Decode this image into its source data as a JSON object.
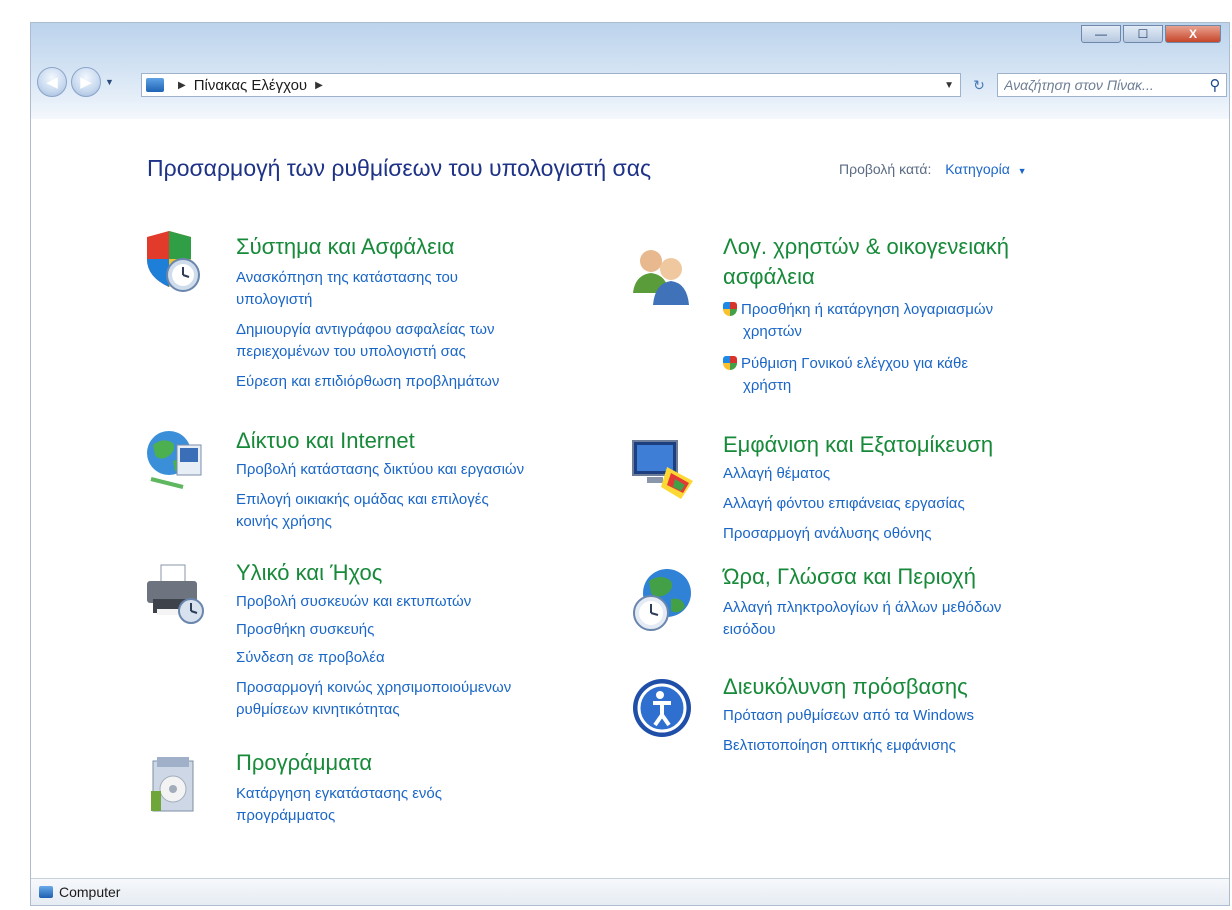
{
  "window": {
    "controls": {
      "minimize": "—",
      "maximize": "☐",
      "close": "X"
    }
  },
  "nav": {
    "back_icon": "back-arrow-icon",
    "forward_icon": "forward-arrow-icon"
  },
  "address": {
    "crumb": "Πίνακας Ελέγχου"
  },
  "search": {
    "placeholder": "Αναζήτηση στον Πίνακ..."
  },
  "header": {
    "title": "Προσαρμογή των ρυθμίσεων του υπολογιστή σας",
    "view_by_label": "Προβολή κατά:",
    "view_by_value": "Κατηγορία"
  },
  "categories": {
    "system": {
      "title": "Σύστημα και Ασφάλεια",
      "links": [
        "Ανασκόπηση της κατάστασης του",
        "υπολογιστή",
        "Δημιουργία αντιγράφου ασφαλείας των",
        "περιεχομένων του υπολογιστή σας",
        "Εύρεση και επιδιόρθωση προβλημάτων"
      ]
    },
    "network": {
      "title": "Δίκτυο και Internet",
      "links": [
        "Προβολή κατάστασης δικτύου και εργασιών",
        "Επιλογή οικιακής ομάδας και επιλογές",
        "κοινής χρήσης"
      ]
    },
    "hardware": {
      "title": "Υλικό και Ήχος",
      "links": [
        "Προβολή συσκευών και εκτυπωτών",
        "Προσθήκη συσκευής",
        "Σύνδεση σε προβολέα",
        "Προσαρμογή κοινώς χρησιμοποιούμενων",
        "ρυθμίσεων κινητικότητας"
      ]
    },
    "programs": {
      "title": "Προγράμματα",
      "links": [
        "Κατάργηση εγκατάστασης ενός",
        "προγράμματος"
      ]
    },
    "users": {
      "title_line1": "Λογ. χρηστών & οικογενειακή",
      "title_line2": "ασφάλεια",
      "links": [
        "Προσθήκη ή κατάργηση λογαριασμών",
        "χρηστών",
        "Ρύθμιση Γονικού ελέγχου για κάθε",
        "χρήστη"
      ]
    },
    "appearance": {
      "title": "Εμφάνιση και Εξατομίκευση",
      "links": [
        "Αλλαγή θέματος",
        "Αλλαγή φόντου επιφάνειας εργασίας",
        "Προσαρμογή ανάλυσης οθόνης"
      ]
    },
    "clock": {
      "title": "Ώρα, Γλώσσα και Περιοχή",
      "links": [
        "Αλλαγή πληκτρολογίων ή άλλων μεθόδων",
        "εισόδου"
      ]
    },
    "access": {
      "title": "Διευκόλυνση πρόσβασης",
      "links": [
        "Πρόταση ρυθμίσεων από τα Windows",
        "Βελτιστοποίηση οπτικής εμφάνισης"
      ]
    }
  },
  "statusbar": {
    "text": "Computer"
  }
}
